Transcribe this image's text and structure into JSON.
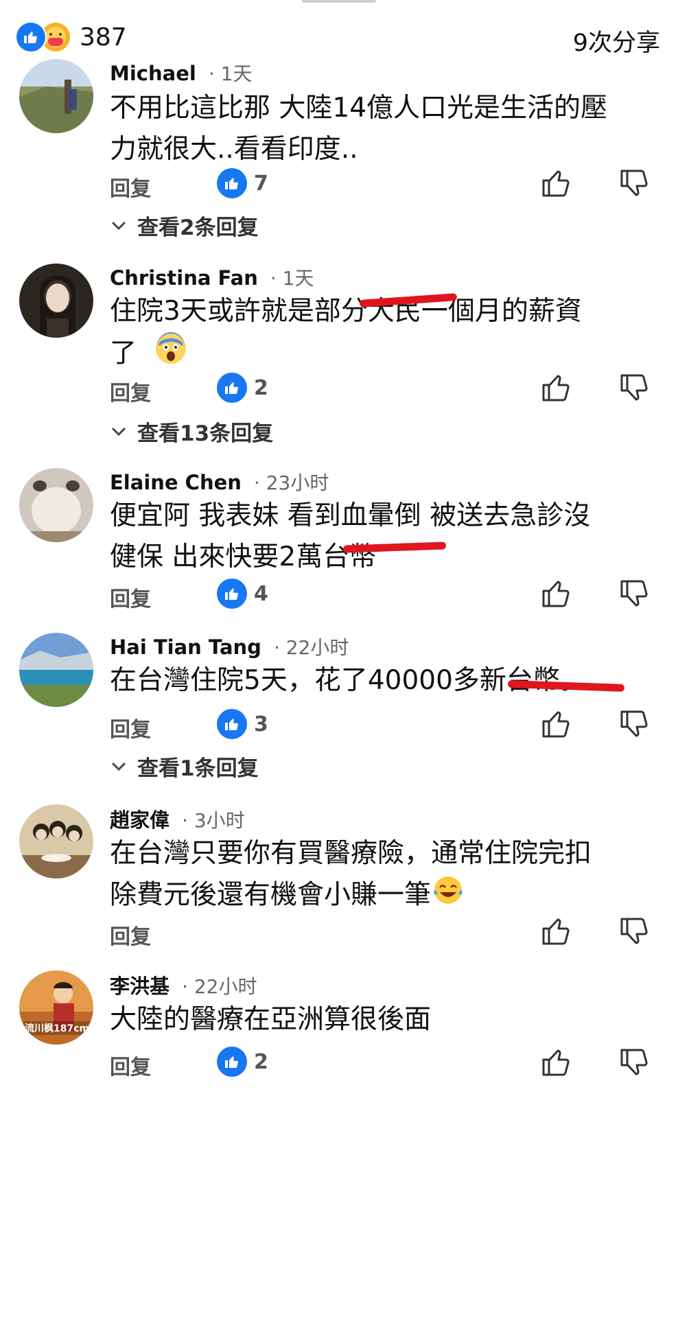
{
  "header": {
    "reaction_count": "387",
    "shares_label": "9次分享",
    "reaction_icons": [
      "like-icon",
      "care-icon"
    ]
  },
  "comments": [
    {
      "author": "Michael",
      "time": "· 1天",
      "lines": [
        "不用比這比那 大陸14億人口光是生活的壓",
        "力就很大..看看印度.."
      ],
      "reply_label": "回复",
      "likes": "7",
      "view_replies": "查看2条回复"
    },
    {
      "author": "Christina Fan",
      "time": "· 1天",
      "lines": [
        "住院3天或許就是部分大民一個月的薪資",
        "了"
      ],
      "emoji": "fearful-face-emoji",
      "reply_label": "回复",
      "likes": "2",
      "view_replies": "查看13条回复"
    },
    {
      "author": "Elaine Chen",
      "time": "· 23小时",
      "lines": [
        "便宜阿 我表妹 看到血暈倒 被送去急診沒",
        "健保 出來快要2萬台幣"
      ],
      "reply_label": "回复",
      "likes": "4"
    },
    {
      "author": "Hai Tian Tang",
      "time": "· 22小时",
      "lines": [
        "在台灣住院5天，花了40000多新台幣。"
      ],
      "reply_label": "回复",
      "likes": "3",
      "view_replies": "查看1条回复"
    },
    {
      "author": "趙家偉",
      "time": "· 3小时",
      "lines": [
        "在台灣只要你有買醫療險，通常住院完扣",
        "除費元後還有機會小賺一筆"
      ],
      "emoji": "tears-of-joy-emoji",
      "reply_label": "回复"
    },
    {
      "author": "李洪基",
      "time": "· 22小时",
      "lines": [
        "大陸的醫療在亞洲算很後面"
      ],
      "reply_label": "回复",
      "likes": "2",
      "avatar_caption": "流川枫187cm"
    }
  ],
  "colors": {
    "facebook_blue": "#1877f2",
    "strike_red": "#e0161e",
    "muted_text": "#666666"
  }
}
